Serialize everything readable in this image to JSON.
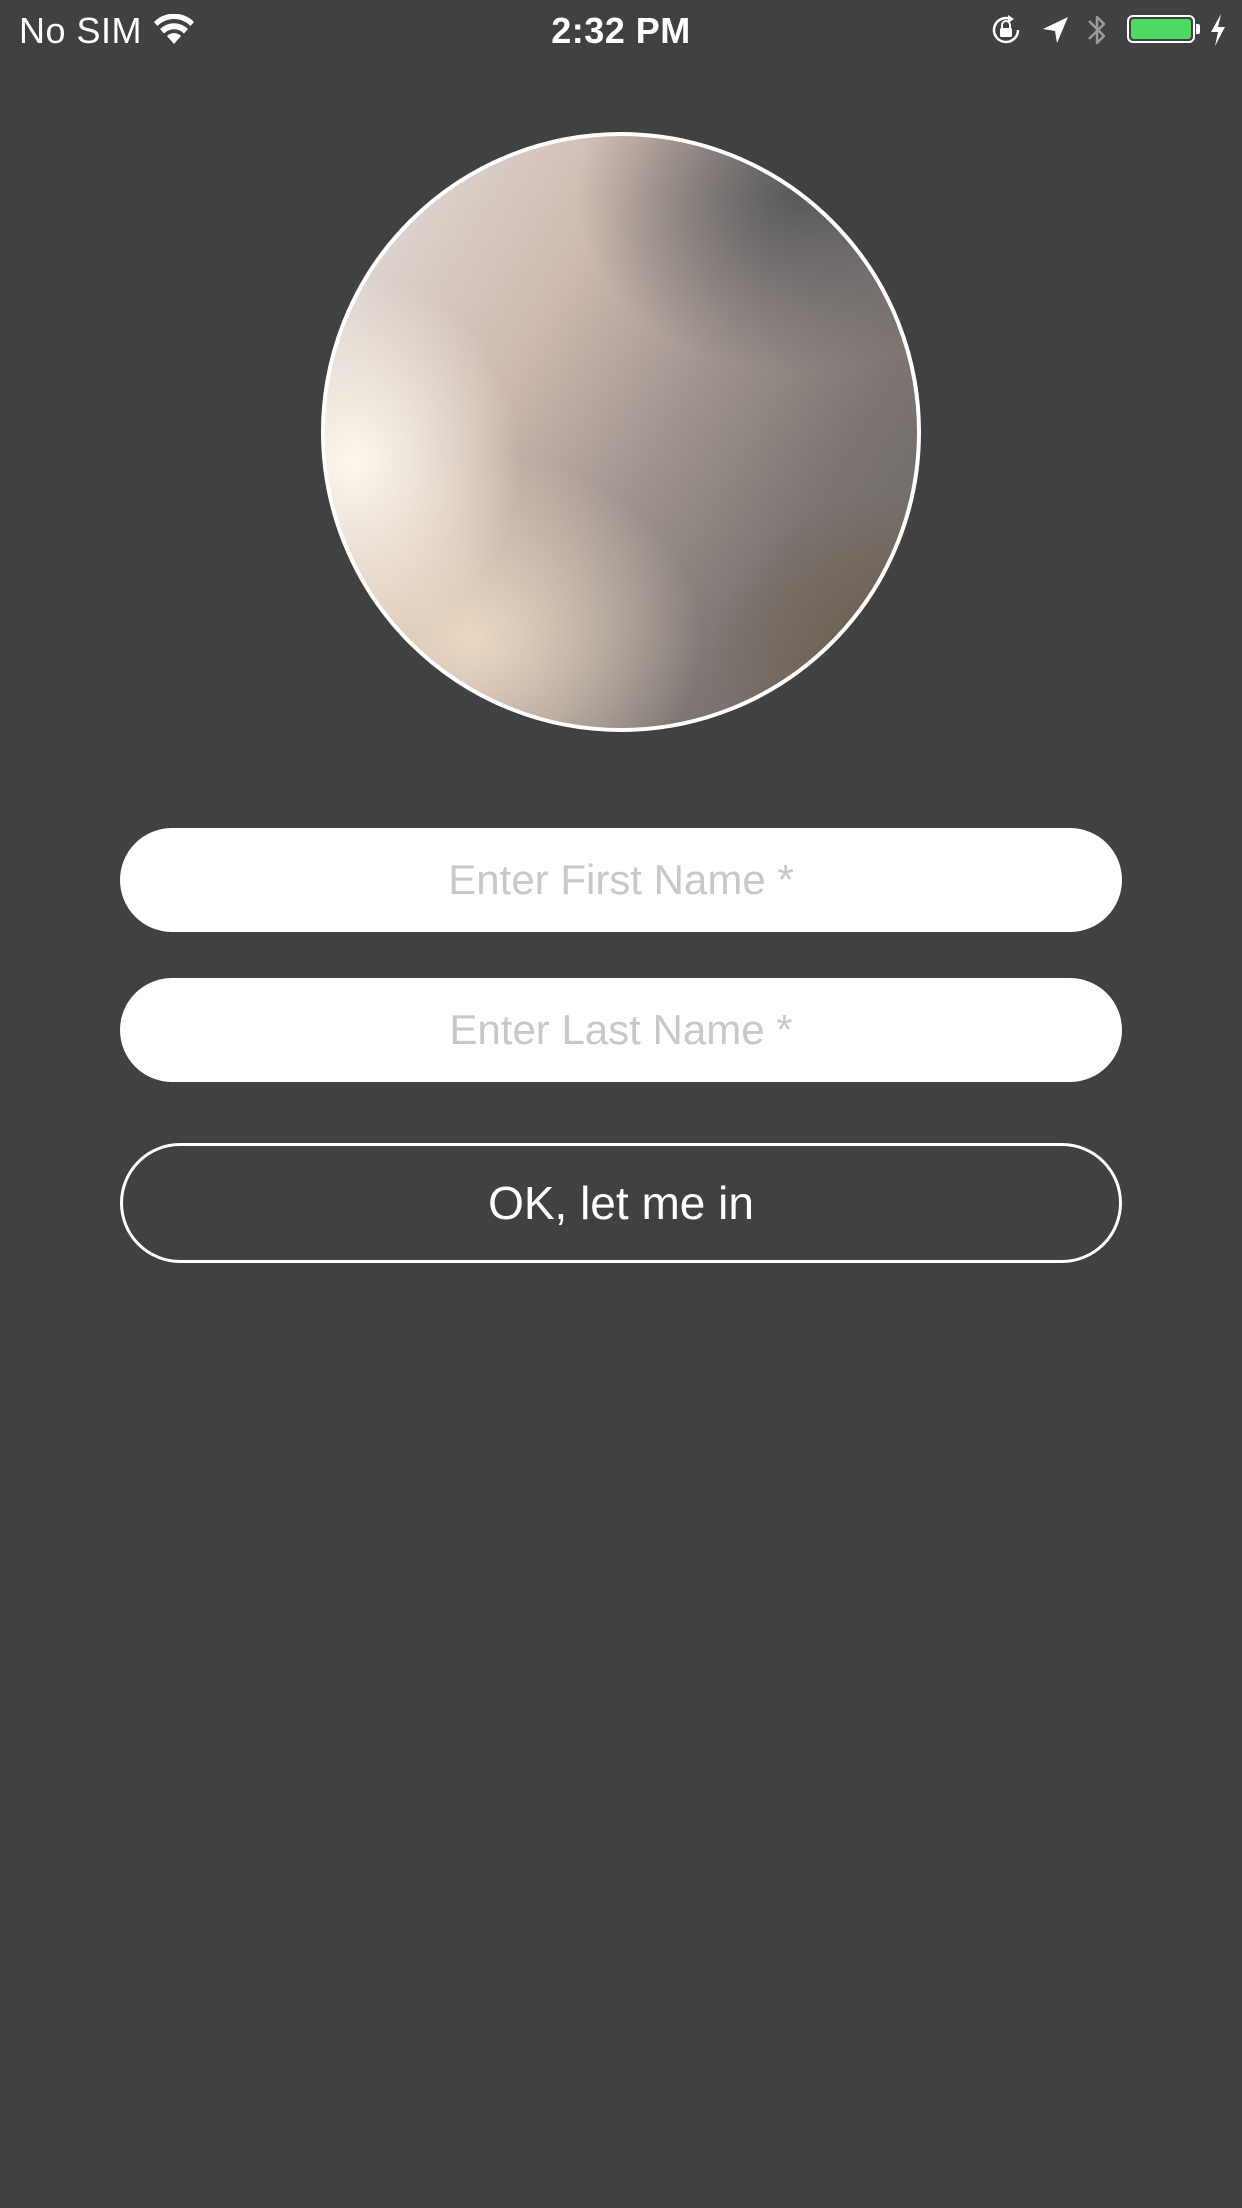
{
  "status_bar": {
    "carrier": "No SIM",
    "time": "2:32 PM",
    "battery_level": 1.0,
    "charging": true,
    "icons": [
      "wifi-icon",
      "orientation-lock-icon",
      "location-icon",
      "bluetooth-icon",
      "battery-icon",
      "charging-bolt-icon"
    ],
    "battery_color": "#4cd964"
  },
  "avatar": {
    "icon": "profile-photo"
  },
  "form": {
    "first_name_placeholder": "Enter First Name *",
    "first_name_value": "",
    "last_name_placeholder": "Enter Last Name *",
    "last_name_value": "",
    "submit_label": "OK, let me in"
  },
  "colors": {
    "background": "#414141",
    "field_background": "#ffffff",
    "placeholder": "#c7c7cc",
    "button_border": "#ffffff"
  }
}
